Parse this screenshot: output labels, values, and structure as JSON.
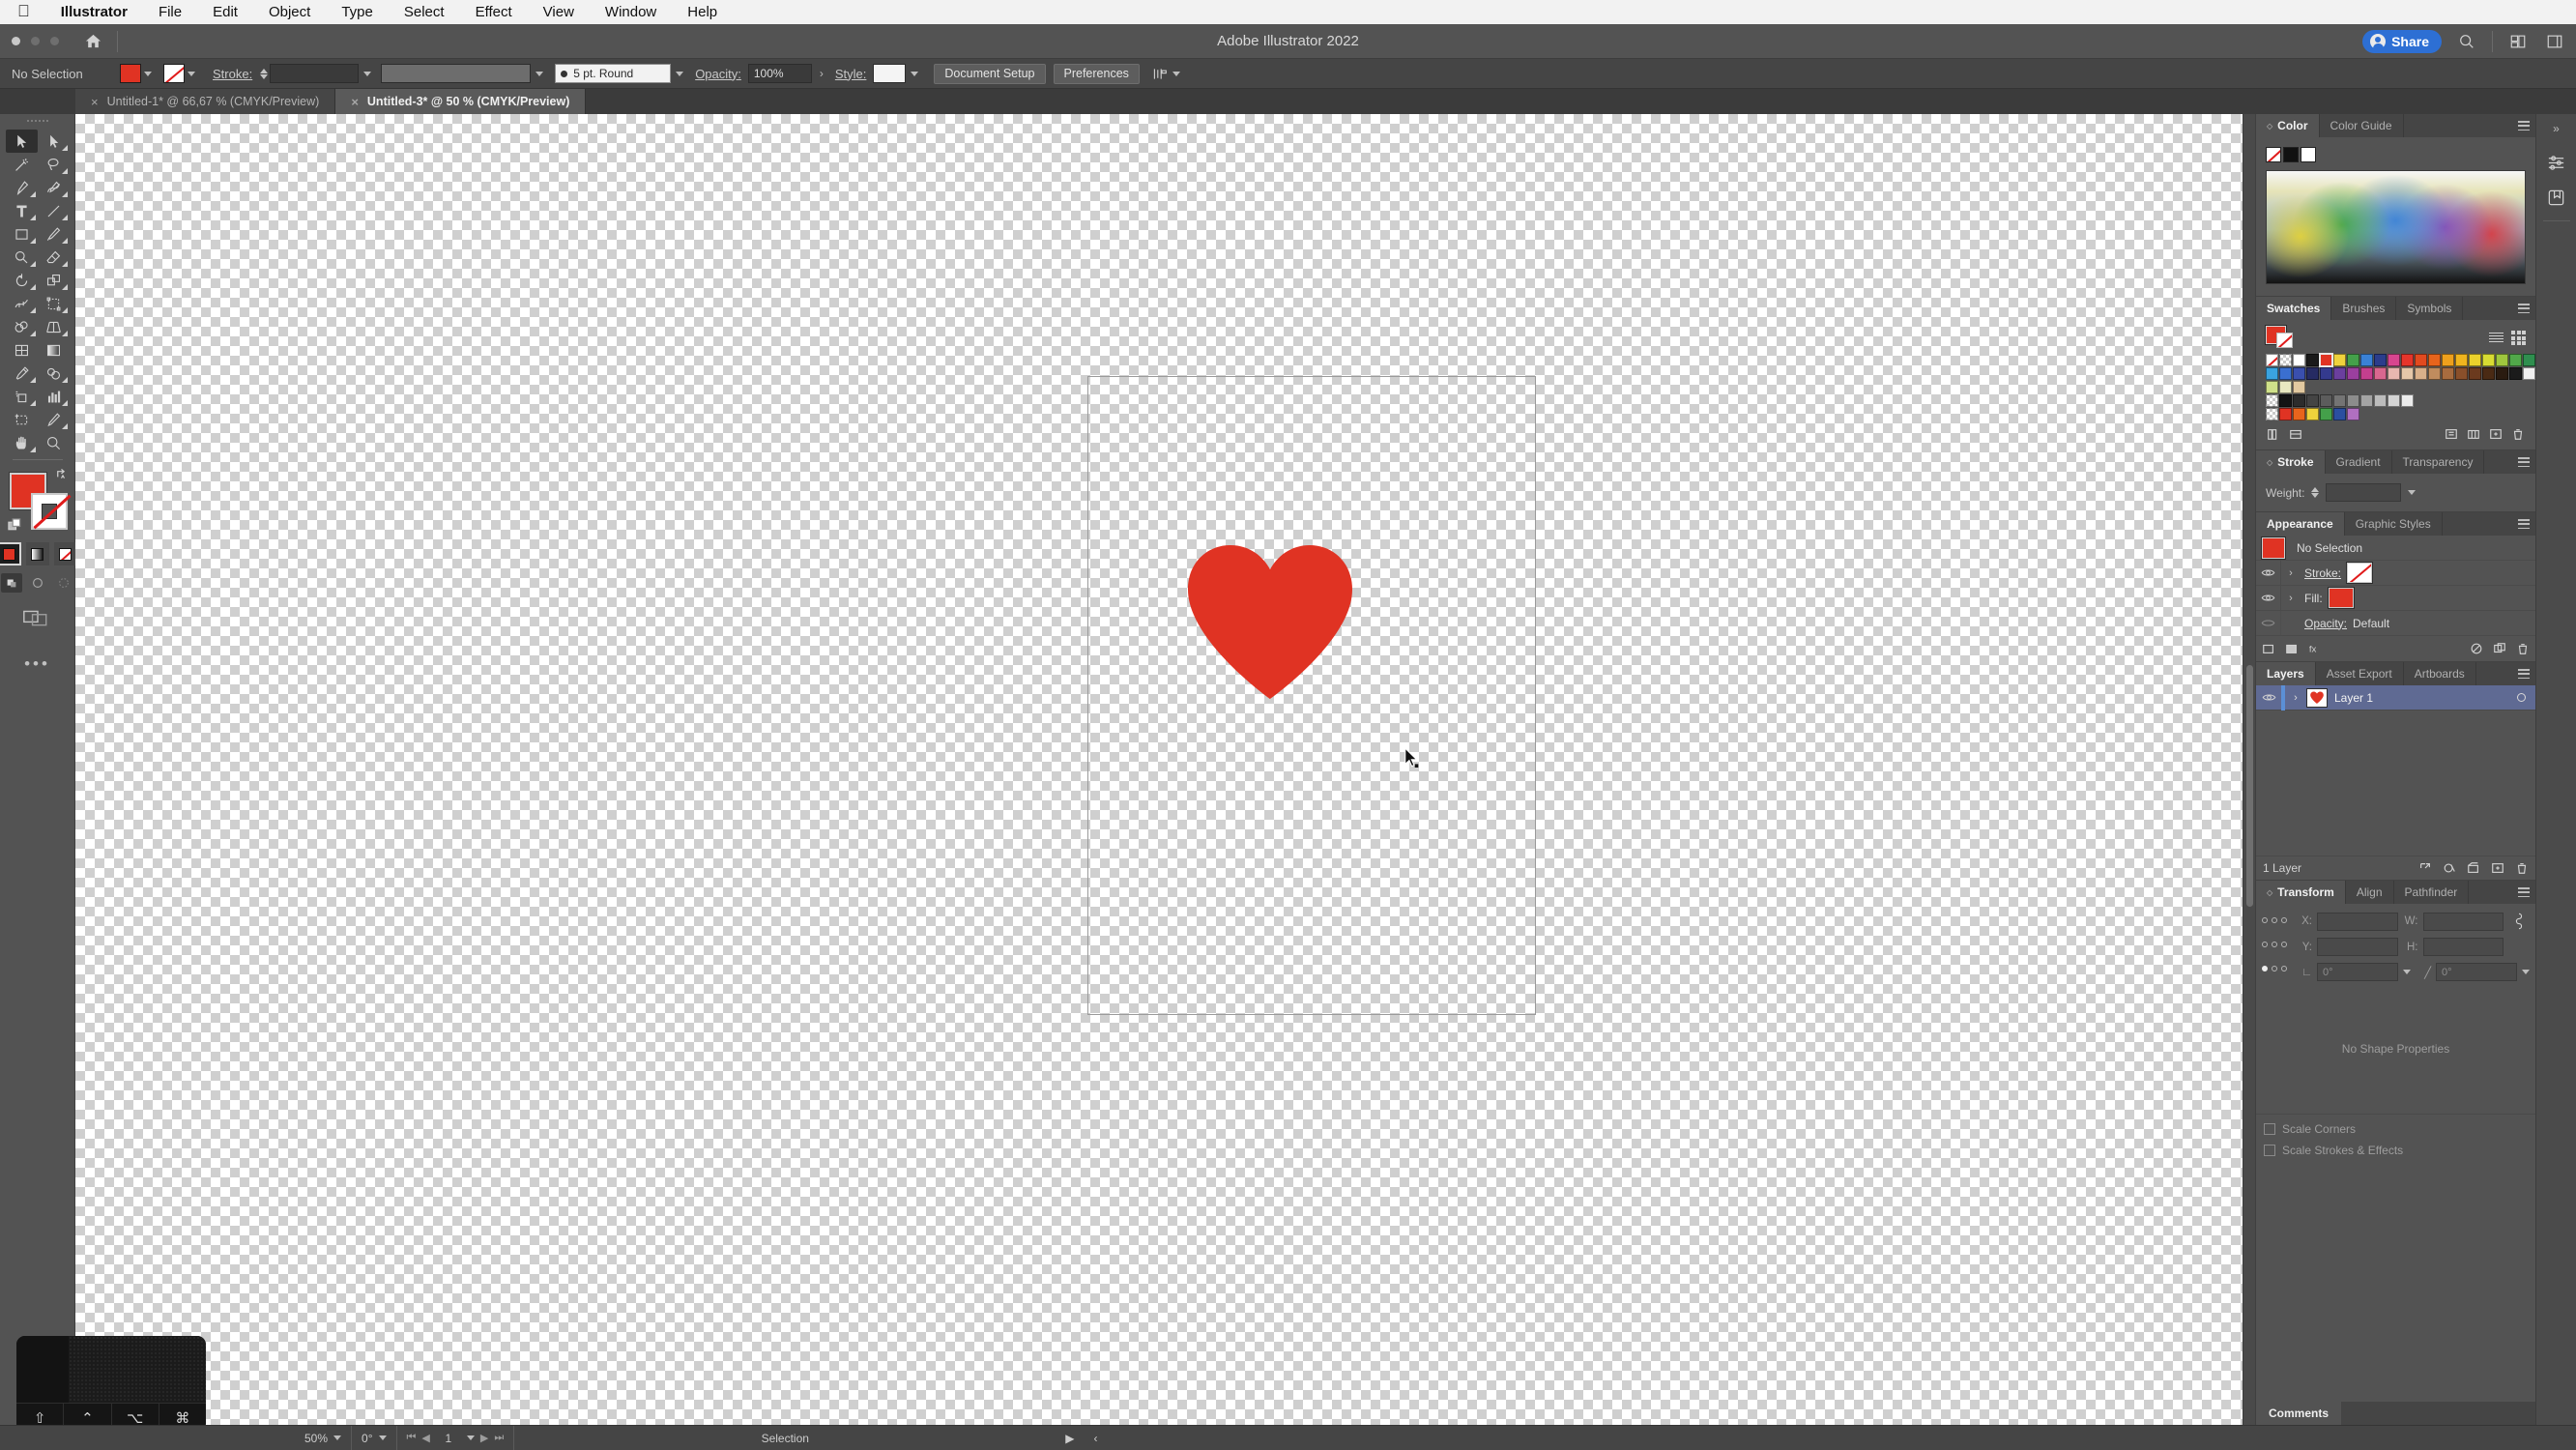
{
  "macmenu": {
    "apple": "apple-logo",
    "items": [
      "Illustrator",
      "File",
      "Edit",
      "Object",
      "Type",
      "Select",
      "Effect",
      "View",
      "Window",
      "Help"
    ]
  },
  "titlebar": {
    "title": "Adobe Illustrator 2022",
    "home_icon": "home-icon",
    "share_label": "Share",
    "search_icon": "search-icon",
    "arrange_icon": "arrange-documents-icon",
    "workspace_icon": "workspace-switcher-icon"
  },
  "controlbar": {
    "selection_status": "No Selection",
    "fill_color": "#e03323",
    "stroke_label": "Stroke:",
    "stroke_weight": "",
    "stroke_profile": "5 pt. Round",
    "opacity_label": "Opacity:",
    "opacity_value": "100%",
    "style_label": "Style:",
    "document_setup": "Document Setup",
    "preferences": "Preferences",
    "align_icon": "align-options-icon"
  },
  "tabs": [
    {
      "title": "Untitled-1* @ 66,67 % (CMYK/Preview)",
      "active": false
    },
    {
      "title": "Untitled-3* @ 50 % (CMYK/Preview)",
      "active": true
    }
  ],
  "toolbar": {
    "tools": [
      "selection-tool",
      "direct-selection-tool",
      "magic-wand-tool",
      "lasso-tool",
      "pen-tool",
      "curvature-tool",
      "type-tool",
      "line-segment-tool",
      "rectangle-tool",
      "paintbrush-tool",
      "shaper-tool",
      "eraser-tool",
      "rotate-tool",
      "scale-tool",
      "width-tool",
      "free-transform-tool",
      "shape-builder-tool",
      "perspective-grid-tool",
      "mesh-tool",
      "gradient-tool",
      "eyedropper-tool",
      "blend-tool",
      "symbol-sprayer-tool",
      "column-graph-tool",
      "artboard-tool",
      "slice-tool",
      "hand-tool",
      "zoom-tool"
    ],
    "fill_color": "#e03323",
    "stroke_color": "none",
    "fill_swatch_name": "fill-swatch",
    "stroke_swatch_name": "stroke-swatch",
    "color_mode": "color",
    "more_tools": "edit-toolbar-icon"
  },
  "canvas": {
    "artboard_name": "artboard-1",
    "shape": {
      "name": "heart-shape",
      "color": "#e03323"
    },
    "cursor": "selection-cursor"
  },
  "statusbar": {
    "zoom": "50%",
    "rotation": "0°",
    "artboard_number": "1",
    "tool_status": "Selection"
  },
  "modifier_overlay": {
    "keys": [
      "⇧",
      "⌃",
      "⌥",
      "⌘"
    ]
  },
  "panels": {
    "color": {
      "tabs": [
        {
          "label": "Color",
          "active": true
        },
        {
          "label": "Color Guide",
          "active": false
        }
      ],
      "swatch_none": "none-swatch",
      "swatch_black": "black-swatch",
      "swatch_white": "white-swatch",
      "spectrum": "color-spectrum-ramp"
    },
    "swatches": {
      "tabs": [
        {
          "label": "Swatches",
          "active": true
        },
        {
          "label": "Brushes",
          "active": false
        },
        {
          "label": "Symbols",
          "active": false
        }
      ],
      "current_fill": "#e03323",
      "rows": [
        [
          "none",
          "registration",
          "#ffffff",
          "#1a1a1a",
          "#e03323",
          "#efd23c",
          "#44a04a",
          "#3a81d6",
          "#2b3d8c",
          "#d8458f",
          "#e5352b",
          "#e24a1f",
          "#e8641c",
          "#eea01d",
          "#f0b51e",
          "#ead12c",
          "#d8dc33",
          "#9fc73e",
          "#51a84a",
          "#2f8f4f",
          "#1d5c36",
          "#2aa87a",
          "#1fa5a0"
        ],
        [
          "#3aa3e0",
          "#3a6fd0",
          "#3a4fae",
          "#262b63",
          "#343a8e",
          "#6b3f9e",
          "#9b3f9e",
          "#c43f8e",
          "#d9678f",
          "#e8b6b0",
          "#e5c7a9",
          "#d9b08a",
          "#c08c5e",
          "#a86c3f",
          "#8a4f2a",
          "#6b3a1e",
          "#4a2a14",
          "#2a1b10",
          "#1b1b1b",
          "#f0f0f0",
          "#f0a92c",
          "#4a8fd0",
          "#ffffff"
        ],
        [
          "#cfe08a",
          "#e8e8c0",
          "#e2c9a0"
        ],
        [
          "reg",
          "#141414",
          "#2c2c2c",
          "#444444",
          "#5c5c5c",
          "#747474",
          "#8c8c8c",
          "#a4a4a4",
          "#bcbcbc",
          "#d4d4d4",
          "#ececec"
        ],
        [
          "reg",
          "#e03323",
          "#e8641c",
          "#efd23c",
          "#44a04a",
          "#2b4fa0",
          "#b06fc0"
        ]
      ],
      "footer_icons": [
        "swatch-libraries-icon",
        "show-swatch-kinds-icon",
        "swatch-options-icon",
        "new-color-group-icon",
        "new-swatch-icon",
        "delete-swatch-icon"
      ]
    },
    "stroke": {
      "tabs": [
        {
          "label": "Stroke",
          "active": true
        },
        {
          "label": "Gradient",
          "active": false
        },
        {
          "label": "Transparency",
          "active": false
        }
      ],
      "weight_label": "Weight:",
      "weight_value": ""
    },
    "appearance": {
      "tabs": [
        {
          "label": "Appearance",
          "active": true
        },
        {
          "label": "Graphic Styles",
          "active": false
        }
      ],
      "object_label": "No Selection",
      "rows": [
        {
          "label": "Stroke:",
          "kind": "stroke",
          "visible": true
        },
        {
          "label": "Fill:",
          "kind": "fill",
          "visible": true,
          "color": "#e03323"
        }
      ],
      "opacity_label": "Opacity:",
      "opacity_value": "Default",
      "footer_icons": [
        "add-new-stroke-icon",
        "add-new-fill-icon",
        "add-new-effect-icon",
        "clear-appearance-icon",
        "duplicate-item-icon",
        "delete-item-icon"
      ]
    },
    "layers": {
      "tabs": [
        {
          "label": "Layers",
          "active": true
        },
        {
          "label": "Asset Export",
          "active": false
        },
        {
          "label": "Artboards",
          "active": false
        }
      ],
      "items": [
        {
          "name": "Layer 1",
          "visible": true,
          "selected": true,
          "thumb": "heart-thumbnail"
        }
      ],
      "count_label": "1 Layer",
      "footer_icons": [
        "locate-object-icon",
        "make-clipping-mask-icon",
        "create-new-sublayer-icon",
        "create-new-layer-icon",
        "delete-selection-icon"
      ]
    },
    "transform": {
      "tabs": [
        {
          "label": "Transform",
          "active": true
        },
        {
          "label": "Align",
          "active": false
        },
        {
          "label": "Pathfinder",
          "active": false
        }
      ],
      "fields": [
        {
          "label": "X:",
          "value": ""
        },
        {
          "label": "W:",
          "value": ""
        },
        {
          "label": "Y:",
          "value": ""
        },
        {
          "label": "H:",
          "value": ""
        }
      ],
      "angle_label": "⊿:",
      "angle_value": "0°",
      "shear_label": "shear:",
      "shear_value": "0°",
      "link_icon": "constrain-proportions-icon",
      "no_shape_properties": "No Shape Properties",
      "scale_corners": "Scale Corners",
      "scale_strokes": "Scale Strokes & Effects"
    },
    "comments": {
      "label": "Comments"
    }
  },
  "rail": {
    "collapse_icon": "collapse-panels-icon",
    "icons": [
      "properties-panel-icon",
      "libraries-panel-icon"
    ]
  },
  "colors": {
    "accent_red": "#e03323",
    "share_blue": "#2d6fd4",
    "panel_bg": "#535353",
    "layer_selected": "#5f6a93"
  }
}
